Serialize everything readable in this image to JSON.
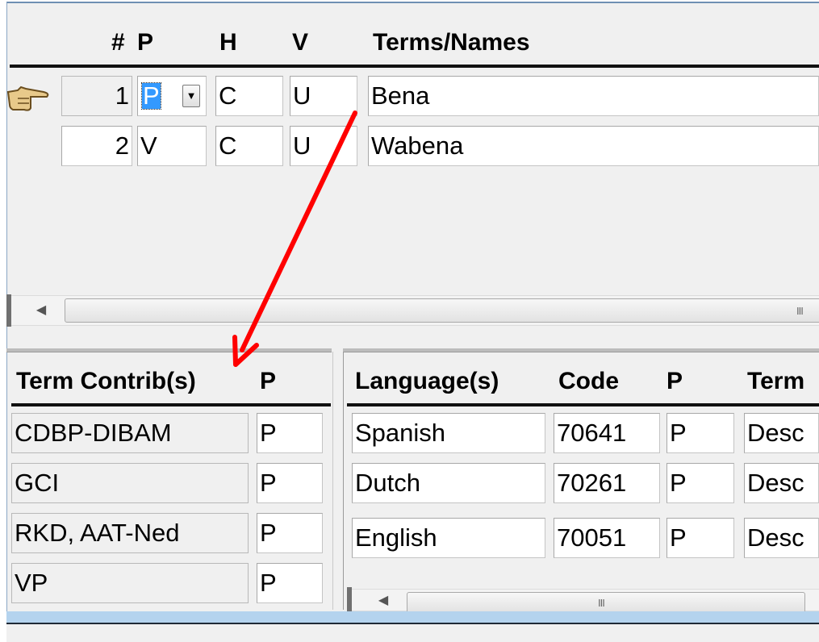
{
  "terms_grid": {
    "headers": {
      "num": "#",
      "p": "P",
      "h": "H",
      "v": "V",
      "term": "Terms/Names"
    },
    "rows": [
      {
        "num": "1",
        "p": "P",
        "h": "C",
        "v": "U",
        "term": "Bena"
      },
      {
        "num": "2",
        "p": "V",
        "h": "C",
        "v": "U",
        "term": "Wabena"
      }
    ],
    "scroll_grip": "III"
  },
  "contrib_grid": {
    "headers": {
      "contrib": "Term Contrib(s)",
      "p": "P"
    },
    "rows": [
      {
        "contrib": "CDBP-DIBAM",
        "p": "P"
      },
      {
        "contrib": "GCI",
        "p": "P"
      },
      {
        "contrib": "RKD, AAT-Ned",
        "p": "P"
      },
      {
        "contrib": "VP",
        "p": "P"
      }
    ]
  },
  "language_grid": {
    "headers": {
      "language": "Language(s)",
      "code": "Code",
      "p": "P",
      "term": "Term"
    },
    "rows": [
      {
        "language": "Spanish",
        "code": "70641",
        "p": "P",
        "term": "Desc"
      },
      {
        "language": "Dutch",
        "code": "70261",
        "p": "P",
        "term": "Desc"
      },
      {
        "language": "English",
        "code": "70051",
        "p": "P",
        "term": "Desc"
      }
    ],
    "scroll_grip": "III"
  },
  "icons": {
    "row_pointer": "pointing-hand-icon",
    "dropdown": "chevron-down-icon",
    "scroll_left": "scroll-left-arrow-icon",
    "annotation": "red-arrow-annotation"
  },
  "colors": {
    "selection": "#3399ff",
    "annotation_arrow": "#ff0000",
    "frame_border": "#6f8fb3",
    "status_bar": "#b4d3ee"
  }
}
